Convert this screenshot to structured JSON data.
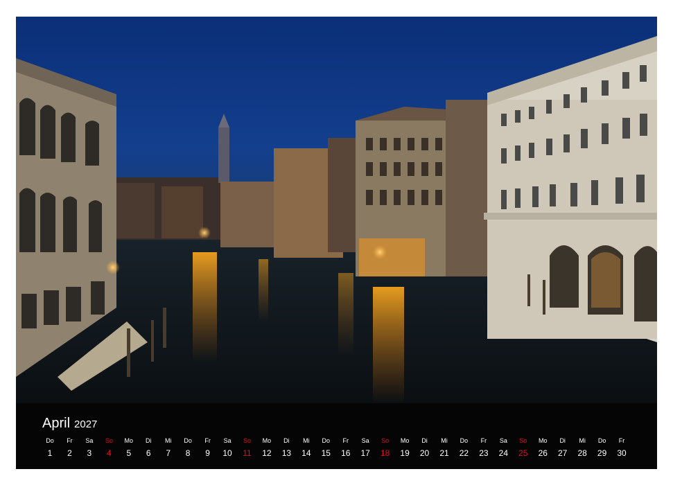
{
  "calendar": {
    "month": "April",
    "year": "2027",
    "sunday_color": "#e0141c",
    "days": [
      {
        "dow": "Do",
        "num": "1"
      },
      {
        "dow": "Fr",
        "num": "2"
      },
      {
        "dow": "Sa",
        "num": "3"
      },
      {
        "dow": "So",
        "num": "4",
        "sunday": true
      },
      {
        "dow": "Mo",
        "num": "5"
      },
      {
        "dow": "Di",
        "num": "6"
      },
      {
        "dow": "Mi",
        "num": "7"
      },
      {
        "dow": "Do",
        "num": "8"
      },
      {
        "dow": "Fr",
        "num": "9"
      },
      {
        "dow": "Sa",
        "num": "10"
      },
      {
        "dow": "So",
        "num": "11",
        "sunday": true
      },
      {
        "dow": "Mo",
        "num": "12"
      },
      {
        "dow": "Di",
        "num": "13"
      },
      {
        "dow": "Mi",
        "num": "14"
      },
      {
        "dow": "Do",
        "num": "15"
      },
      {
        "dow": "Fr",
        "num": "16"
      },
      {
        "dow": "Sa",
        "num": "17"
      },
      {
        "dow": "So",
        "num": "18",
        "sunday": true
      },
      {
        "dow": "Mo",
        "num": "19"
      },
      {
        "dow": "Di",
        "num": "20"
      },
      {
        "dow": "Mi",
        "num": "21"
      },
      {
        "dow": "Do",
        "num": "22"
      },
      {
        "dow": "Fr",
        "num": "23"
      },
      {
        "dow": "Sa",
        "num": "24"
      },
      {
        "dow": "So",
        "num": "25",
        "sunday": true
      },
      {
        "dow": "Mo",
        "num": "26"
      },
      {
        "dow": "Di",
        "num": "27"
      },
      {
        "dow": "Mi",
        "num": "28"
      },
      {
        "dow": "Do",
        "num": "29"
      },
      {
        "dow": "Fr",
        "num": "30"
      }
    ]
  }
}
